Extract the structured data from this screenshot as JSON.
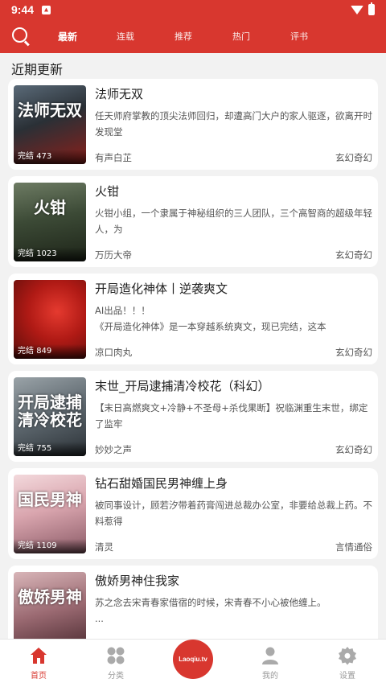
{
  "status_bar": {
    "time": "9:44"
  },
  "top_nav": {
    "tabs": [
      {
        "label": "最新",
        "active": true
      },
      {
        "label": "连载",
        "active": false
      },
      {
        "label": "推荐",
        "active": false
      },
      {
        "label": "热门",
        "active": false
      },
      {
        "label": "评书",
        "active": false
      }
    ]
  },
  "section": {
    "title": "近期更新"
  },
  "books": [
    {
      "title": "法师无双",
      "cover_label": "法师无双",
      "status": "完结",
      "count": "473",
      "desc": "任天师府掌教的顶尖法师回归，却遭高门大户的家人驱逐，欲离开时发现堂",
      "narrator": "有声白芷",
      "genre": "玄幻奇幻"
    },
    {
      "title": "火钳",
      "cover_label": "火钳",
      "status": "完结",
      "count": "1023",
      "desc": "火钳小组，一个隶属于神秘组织的三人团队，三个高智商的超级年轻人，为",
      "narrator": "万历大帝",
      "genre": "玄幻奇幻"
    },
    {
      "title": "开局造化神体丨逆袭爽文",
      "cover_label": "",
      "status": "完结",
      "count": "849",
      "desc": "AI出品！！！\n《开局造化神体》是一本穿越系统爽文，现已完结，这本",
      "narrator": "凉口肉丸",
      "genre": "玄幻奇幻"
    },
    {
      "title": "末世_开局逮捕清冷校花（科幻）",
      "cover_label": "开局逮捕清冷校花",
      "status": "完结",
      "count": "755",
      "desc": "【末日高燃爽文+冷静+不圣母+杀伐果断】祝临渊重生末世，绑定了监牢",
      "narrator": "妙妙之声",
      "genre": "玄幻奇幻"
    },
    {
      "title": "钻石甜婚国民男神缠上身",
      "cover_label": "国民男神",
      "status": "完结",
      "count": "1109",
      "desc": "被同事设计，顾若汐带着药膏闯进总裁办公室，非要给总裁上药。不料惹得",
      "narrator": "清灵",
      "genre": "言情通俗"
    },
    {
      "title": "傲娇男神住我家",
      "cover_label": "傲娇男神",
      "status": "",
      "count": "",
      "desc": "苏之念去宋青春家借宿的时候，宋青春不小心被他缠上。\n...",
      "narrator": "",
      "genre": ""
    }
  ],
  "bottom_nav": {
    "items": [
      {
        "label": "首页",
        "icon": "home-icon",
        "active": true
      },
      {
        "label": "分类",
        "icon": "grid-icon",
        "active": false
      },
      {
        "label": "",
        "icon": "app-logo",
        "logo_text": "Laoqiu.tv",
        "active": false
      },
      {
        "label": "我的",
        "icon": "user-icon",
        "active": false
      },
      {
        "label": "设置",
        "icon": "gear-icon",
        "active": false
      }
    ]
  },
  "colors": {
    "brand": "#d8372f",
    "background": "#f2f2f2"
  }
}
